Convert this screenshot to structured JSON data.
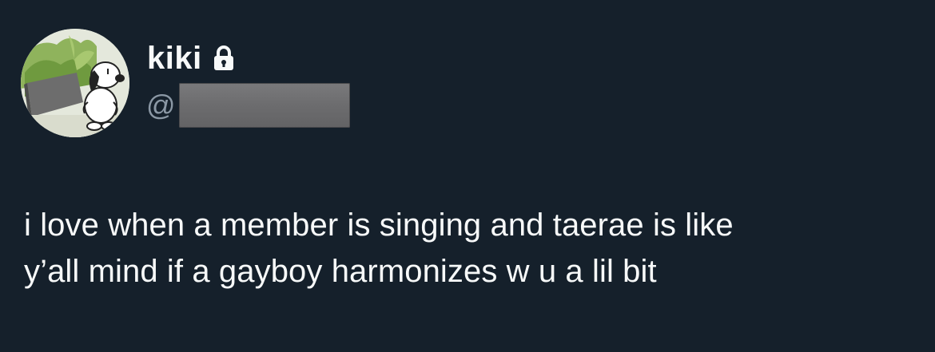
{
  "tweet": {
    "author": {
      "display_name": "kiki",
      "handle_prefix": "@",
      "protected": true,
      "lock_icon": "lock-icon",
      "avatar_icon": "snoopy-avatar"
    },
    "text_lines": [
      "i love when a member is singing and taerae is like",
      "y’all mind if a gayboy harmonizes w u a lil bit"
    ]
  },
  "colors": {
    "background": "#15202b",
    "text_primary": "#f7f9f9",
    "text_secondary": "#8b98a5",
    "redaction": "#6f6f71"
  }
}
